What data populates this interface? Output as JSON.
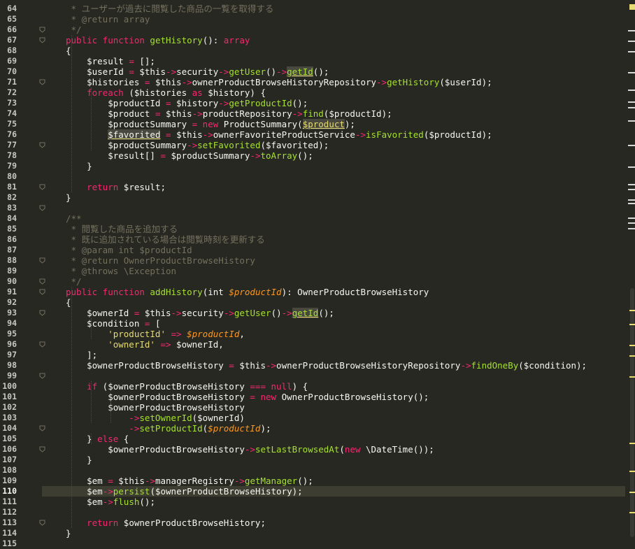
{
  "editor": {
    "first_line_number": 64,
    "current_line": 110,
    "lines": [
      [
        [
          "cm",
          " * ユーザーが過去に閲覧した商品の一覧を取得する"
        ]
      ],
      [
        [
          "cm",
          " * @return array"
        ]
      ],
      [
        [
          "cm",
          " */"
        ]
      ],
      [
        [
          "kw",
          "public function "
        ],
        [
          "fn",
          "getHistory"
        ],
        [
          "plain",
          "(): "
        ],
        [
          "kw",
          "array"
        ]
      ],
      [
        [
          "plain",
          "{"
        ]
      ],
      [
        [
          "plain",
          "    $result "
        ],
        [
          "kw",
          "="
        ],
        [
          "plain",
          " [];"
        ]
      ],
      [
        [
          "plain",
          "    $userId "
        ],
        [
          "kw",
          "="
        ],
        [
          "plain",
          " $this"
        ],
        [
          "kw",
          "->"
        ],
        [
          "plain",
          "security"
        ],
        [
          "kw",
          "->"
        ],
        [
          "fn",
          "getUser"
        ],
        [
          "plain",
          "()"
        ],
        [
          "kw",
          "->"
        ],
        [
          "hl",
          "getId"
        ],
        [
          "plain",
          "();"
        ]
      ],
      [
        [
          "plain",
          "    $histories "
        ],
        [
          "kw",
          "="
        ],
        [
          "plain",
          " $this"
        ],
        [
          "kw",
          "->"
        ],
        [
          "plain",
          "ownerProductBrowseHistoryRepository"
        ],
        [
          "kw",
          "->"
        ],
        [
          "fn",
          "getHistory"
        ],
        [
          "plain",
          "($userId);"
        ]
      ],
      [
        [
          "kw",
          "    foreach"
        ],
        [
          "plain",
          " ($histories "
        ],
        [
          "kw",
          "as"
        ],
        [
          "plain",
          " $history) {"
        ]
      ],
      [
        [
          "plain",
          "        $productId "
        ],
        [
          "kw",
          "="
        ],
        [
          "plain",
          " $history"
        ],
        [
          "kw",
          "->"
        ],
        [
          "fn",
          "getProductId"
        ],
        [
          "plain",
          "();"
        ]
      ],
      [
        [
          "plain",
          "        $product "
        ],
        [
          "kw",
          "="
        ],
        [
          "plain",
          " $this"
        ],
        [
          "kw",
          "->"
        ],
        [
          "plain",
          "productRepository"
        ],
        [
          "kw",
          "->"
        ],
        [
          "fn",
          "find"
        ],
        [
          "plain",
          "($productId);"
        ]
      ],
      [
        [
          "plain",
          "        $productSummary "
        ],
        [
          "kw",
          "="
        ],
        [
          "kw",
          " new"
        ],
        [
          "plain",
          " ProductSummary("
        ],
        [
          "hlv",
          "$product"
        ],
        [
          "plain",
          ");"
        ]
      ],
      [
        [
          "plain",
          "        "
        ],
        [
          "hlw",
          "$favorited"
        ],
        [
          "plain",
          " "
        ],
        [
          "kw",
          "="
        ],
        [
          "plain",
          " $this"
        ],
        [
          "kw",
          "->"
        ],
        [
          "plain",
          "ownerFavoriteProductService"
        ],
        [
          "kw",
          "->"
        ],
        [
          "fn",
          "isFavorited"
        ],
        [
          "plain",
          "($productId);"
        ]
      ],
      [
        [
          "plain",
          "        $productSummary"
        ],
        [
          "kw",
          "->"
        ],
        [
          "fn",
          "setFavorited"
        ],
        [
          "plain",
          "($favorited);"
        ]
      ],
      [
        [
          "plain",
          "        $result[] "
        ],
        [
          "kw",
          "="
        ],
        [
          "plain",
          " $productSummary"
        ],
        [
          "kw",
          "->"
        ],
        [
          "fn",
          "toArray"
        ],
        [
          "plain",
          "();"
        ]
      ],
      [
        [
          "plain",
          "    }"
        ]
      ],
      [],
      [
        [
          "kw",
          "    return"
        ],
        [
          "plain",
          " $result;"
        ]
      ],
      [
        [
          "plain",
          "}"
        ]
      ],
      [],
      [
        [
          "cm",
          "/**"
        ]
      ],
      [
        [
          "cm",
          " * 閲覧した商品を追加する"
        ]
      ],
      [
        [
          "cm",
          " * 既に追加されている場合は閲覧時刻を更新する"
        ]
      ],
      [
        [
          "cm",
          " * @param int $productId"
        ]
      ],
      [
        [
          "cm",
          " * @return OwnerProductBrowseHistory"
        ]
      ],
      [
        [
          "cm",
          " * @throws \\Exception"
        ]
      ],
      [
        [
          "cm",
          " */"
        ]
      ],
      [
        [
          "kw",
          "public function "
        ],
        [
          "fn",
          "addHistory"
        ],
        [
          "plain",
          "(int "
        ],
        [
          "param",
          "$productId"
        ],
        [
          "plain",
          "): OwnerProductBrowseHistory"
        ]
      ],
      [
        [
          "plain",
          "{"
        ]
      ],
      [
        [
          "plain",
          "    $ownerId "
        ],
        [
          "kw",
          "="
        ],
        [
          "plain",
          " $this"
        ],
        [
          "kw",
          "->"
        ],
        [
          "plain",
          "security"
        ],
        [
          "kw",
          "->"
        ],
        [
          "fn",
          "getUser"
        ],
        [
          "plain",
          "()"
        ],
        [
          "kw",
          "->"
        ],
        [
          "hl",
          "getId"
        ],
        [
          "plain",
          "();"
        ]
      ],
      [
        [
          "plain",
          "    $condition "
        ],
        [
          "kw",
          "="
        ],
        [
          "plain",
          " ["
        ]
      ],
      [
        [
          "str",
          "        'productId'"
        ],
        [
          "kw",
          " =>"
        ],
        [
          "plain",
          " "
        ],
        [
          "param",
          "$productId"
        ],
        [
          "plain",
          ","
        ]
      ],
      [
        [
          "str",
          "        'ownerId'"
        ],
        [
          "kw",
          " =>"
        ],
        [
          "plain",
          " $ownerId,"
        ]
      ],
      [
        [
          "plain",
          "    ];"
        ]
      ],
      [
        [
          "plain",
          "    $ownerProductBrowseHistory "
        ],
        [
          "kw",
          "="
        ],
        [
          "plain",
          " $this"
        ],
        [
          "kw",
          "->"
        ],
        [
          "plain",
          "ownerProductBrowseHistoryRepository"
        ],
        [
          "kw",
          "->"
        ],
        [
          "fn",
          "findOneBy"
        ],
        [
          "plain",
          "($condition);"
        ]
      ],
      [],
      [
        [
          "kw",
          "    if"
        ],
        [
          "plain",
          " ($ownerProductBrowseHistory "
        ],
        [
          "kw",
          "==="
        ],
        [
          "kw",
          " null"
        ],
        [
          "plain",
          ") {"
        ]
      ],
      [
        [
          "plain",
          "        $ownerProductBrowseHistory "
        ],
        [
          "kw",
          "="
        ],
        [
          "kw",
          " new"
        ],
        [
          "plain",
          " OwnerProductBrowseHistory();"
        ]
      ],
      [
        [
          "plain",
          "        $ownerProductBrowseHistory"
        ]
      ],
      [
        [
          "kw",
          "            ->"
        ],
        [
          "fn",
          "setOwnerId"
        ],
        [
          "plain",
          "($ownerId)"
        ]
      ],
      [
        [
          "kw",
          "            ->"
        ],
        [
          "fn",
          "setProductId"
        ],
        [
          "plain",
          "("
        ],
        [
          "param",
          "$productId"
        ],
        [
          "plain",
          ");"
        ]
      ],
      [
        [
          "plain",
          "    } "
        ],
        [
          "kw",
          "else"
        ],
        [
          "plain",
          " {"
        ]
      ],
      [
        [
          "plain",
          "        $ownerProductBrowseHistory"
        ],
        [
          "kw",
          "->"
        ],
        [
          "fn",
          "setLastBrowsedAt"
        ],
        [
          "plain",
          "("
        ],
        [
          "kw",
          "new"
        ],
        [
          "plain",
          " \\DateTime());"
        ]
      ],
      [
        [
          "plain",
          "    }"
        ]
      ],
      [],
      [
        [
          "plain",
          "    $em "
        ],
        [
          "kw",
          "="
        ],
        [
          "plain",
          " $this"
        ],
        [
          "kw",
          "->"
        ],
        [
          "plain",
          "managerRegistry"
        ],
        [
          "kw",
          "->"
        ],
        [
          "fn",
          "getManager"
        ],
        [
          "plain",
          "();"
        ]
      ],
      [
        [
          "plain",
          "    $em"
        ],
        [
          "kw",
          "->"
        ],
        [
          "fn",
          "persist"
        ],
        [
          "plain",
          "($ownerProductBrowseHistory);"
        ]
      ],
      [
        [
          "plain",
          "    $em"
        ],
        [
          "kw",
          "->"
        ],
        [
          "fn",
          "flush"
        ],
        [
          "plain",
          "();"
        ]
      ],
      [],
      [
        [
          "kw",
          "    return"
        ],
        [
          "plain",
          " $ownerProductBrowseHistory;"
        ]
      ],
      [
        [
          "plain",
          "}"
        ]
      ]
    ],
    "last_line_brace": "}",
    "colors": {
      "background": "#272822",
      "keyword": "#f92672",
      "function": "#a6e22e",
      "string": "#e6db74",
      "comment": "#75715e",
      "parameter": "#fd971f",
      "text": "#f8f8f2",
      "current_line": "#3e3d32"
    }
  }
}
